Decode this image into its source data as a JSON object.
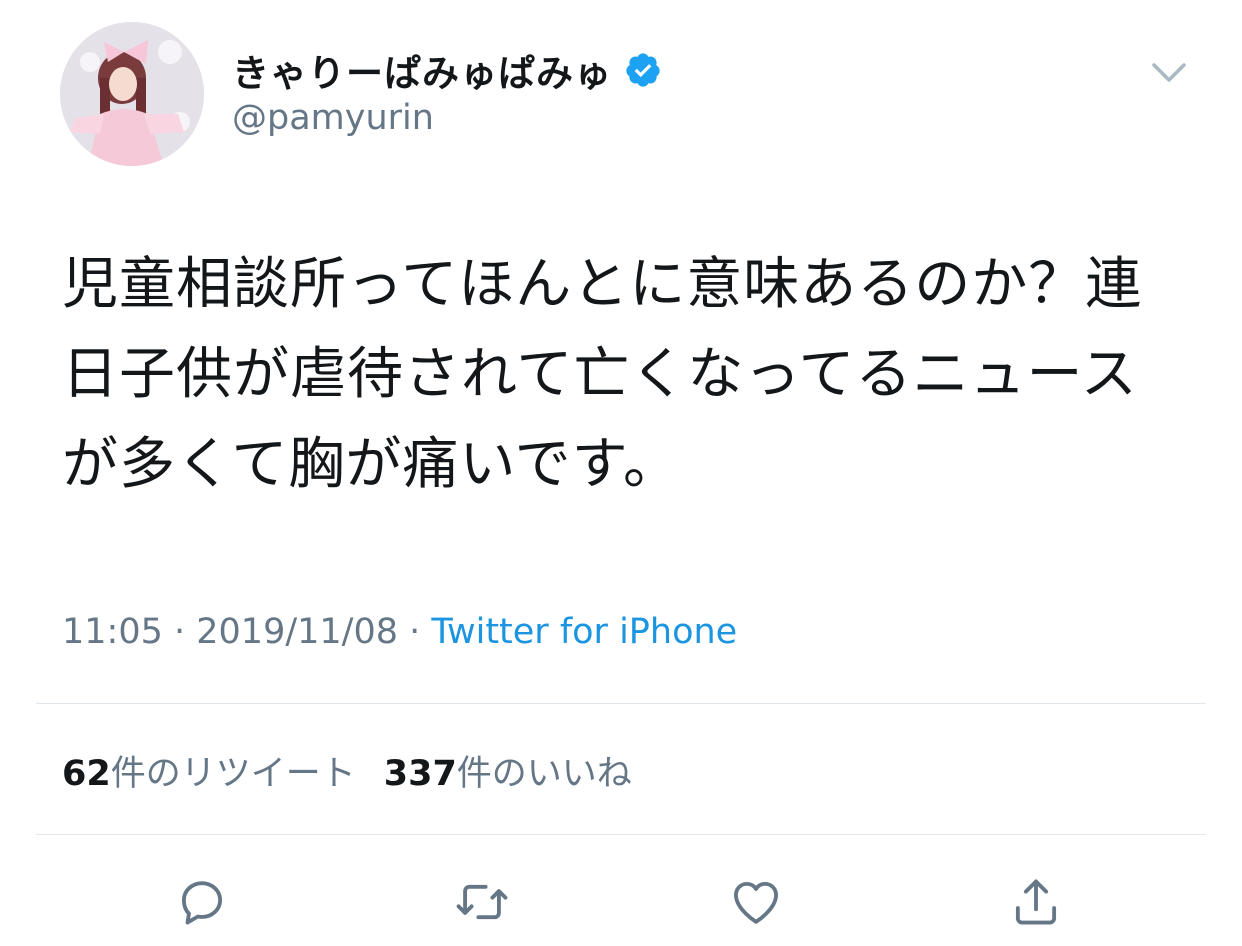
{
  "tweet": {
    "author": {
      "display_name": "きゃりーぱみゅぱみゅ",
      "handle": "@pamyurin",
      "verified": true
    },
    "text": "児童相談所ってほんとに意味あるのか？連\n日子供が虐待されて亡くなってるニュース\nが多くて胸が痛いです。",
    "time": "11:05",
    "separator": " · ",
    "date": "2019/11/08",
    "source": "Twitter for iPhone",
    "stats": {
      "retweet_count": "62",
      "retweet_label": "件のリツイート",
      "like_count": "337",
      "like_label": "件のいいね"
    }
  },
  "colors": {
    "text": "#14171a",
    "secondary": "#657786",
    "link": "#1b95e0",
    "verified": "#1da1f2",
    "divider": "#e1e8ed",
    "icon": "#657786"
  },
  "icons": {
    "menu": "chevron-down-icon",
    "reply": "reply-icon",
    "retweet": "retweet-icon",
    "like": "heart-icon",
    "share": "share-icon"
  }
}
